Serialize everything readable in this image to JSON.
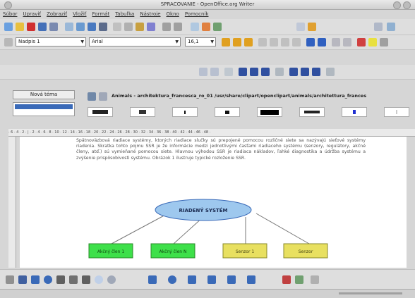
{
  "window": {
    "title": "SPRACOVANIE - OpenOffice.org Writer"
  },
  "menu": [
    "Súbor",
    "Upraviť",
    "Zobraziť",
    "Vložiť",
    "Formát",
    "Tabuľka",
    "Nástroje",
    "Okno",
    "Pomocník"
  ],
  "formatting": {
    "style": "Nadpis 1",
    "font": "Arial",
    "size": "16,1"
  },
  "sidebar": {
    "new_theme_label": "Nová téma",
    "path": "Animals - architektura_francesca_ro_01 /usr/share/clipart/openclipart/animals/architettura_frances"
  },
  "ruler": {
    "marks": "· 6 · 4 · 2 · | · 2 · 4 · 6 · 8 · 10 · 12 · 14 · 16 · 18 · 20 · 22 · 24 · 26 · 28 · 30 · 32 · 34 · 36 · 38 · 40 · 42 · 44 · 46 · 48 ·"
  },
  "document": {
    "paragraph": "Spätnoväzbová riadiace systémy, ktorých riadiace slučky sú prepojené pomocou rozličné siete sa nazývajú sieťové systémy riadenia. Skratka tohto pojmu SSR je že informácie medzi jednotlivými časťami riadiaceho systému (senzory, regulátory, akčné členy, atď.) sú vymieňané pomocou siete. Hlavnou výhodou SSR je riadiaca nákladov, ľahké diagnostika a údržba systému a zvýšenie prispôsobivosti systému. Obrázok 1 ilustruje typické rozloženie SSR.",
    "diagram": {
      "root": "RIADENÝ SYSTÉM",
      "boxes": [
        "Akčný člen 1",
        "Akčný člen N",
        "Senzor 1",
        "Senzor"
      ]
    }
  },
  "colors": {
    "root_fill": "#9ec8ee",
    "actuator_fill": "#3ee04a",
    "sensor_fill": "#e8e060"
  }
}
